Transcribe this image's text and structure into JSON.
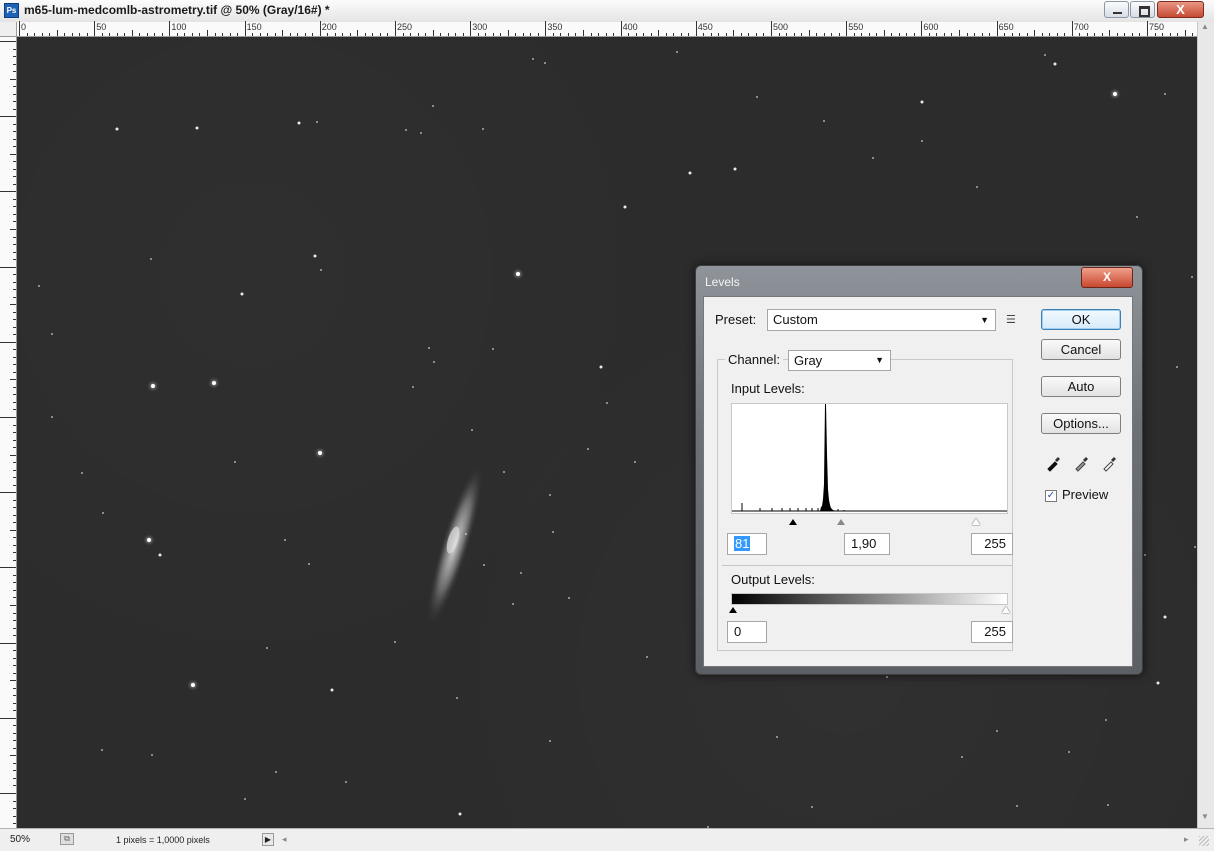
{
  "window": {
    "title": "m65-lum-medcomlb-astrometry.tif @ 50% (Gray/16#) *",
    "close_label": "X"
  },
  "ruler": {
    "labels": [
      "0",
      "50",
      "100",
      "150",
      "200",
      "250",
      "300",
      "350",
      "400",
      "450",
      "500",
      "550",
      "600",
      "650",
      "700",
      "750"
    ]
  },
  "status_bar": {
    "zoom": "50%",
    "info": "1 pixels = 1,0000 pixels",
    "menu_arrow": "▶",
    "scroll_left": "◂",
    "scroll_right": "▸"
  },
  "levels_dialog": {
    "title": "Levels",
    "close_label": "X",
    "preset_label": "Preset:",
    "preset_value": "Custom",
    "channel_label": "Channel:",
    "channel_value": "Gray",
    "input_levels_label": "Input Levels:",
    "input_black": "81",
    "input_gamma": "1,90",
    "input_white": "255",
    "output_levels_label": "Output Levels:",
    "output_black": "0",
    "output_white": "255",
    "buttons": {
      "ok": "OK",
      "cancel": "Cancel",
      "auto": "Auto",
      "options": "Options..."
    },
    "preview_label": "Preview",
    "preview_checked": true,
    "icons": [
      "preset-options-icon",
      "black-eyedropper-icon",
      "gray-eyedropper-icon",
      "white-eyedropper-icon"
    ]
  }
}
